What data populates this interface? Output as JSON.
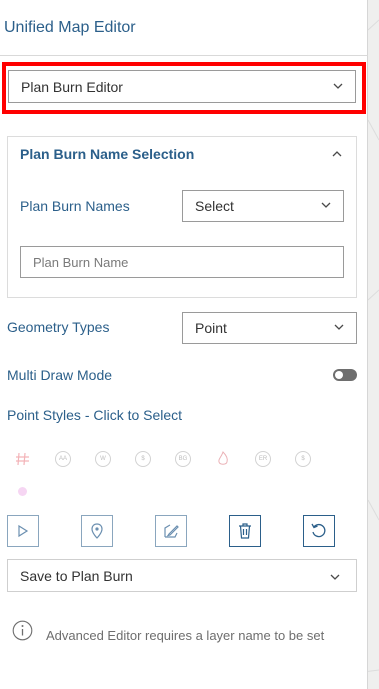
{
  "panel": {
    "title": "Unified Map Editor"
  },
  "editor_select": {
    "value": "Plan Burn Editor"
  },
  "section": {
    "title": "Plan Burn Name Selection",
    "names_label": "Plan Burn Names",
    "names_select_value": "Select",
    "name_input_placeholder": "Plan Burn Name"
  },
  "geometry": {
    "label": "Geometry Types",
    "value": "Point"
  },
  "multi_draw": {
    "label": "Multi Draw Mode",
    "enabled": false
  },
  "point_styles": {
    "label": "Point Styles - Click to Select",
    "icons": [
      "hash-icon",
      "aa-icon",
      "w-icon",
      "s-icon",
      "bg-icon",
      "flame-icon",
      "er-icon",
      "s-icon",
      "dot-icon"
    ]
  },
  "tools": [
    "pointer-icon",
    "marker-icon",
    "edit-icon",
    "trash-icon",
    "refresh-icon"
  ],
  "save": {
    "label": "Save to Plan Burn"
  },
  "info": {
    "text": "Advanced Editor requires a layer name to be set"
  },
  "colors": {
    "accent": "#2b5f8a",
    "highlight": "#ff0000"
  }
}
